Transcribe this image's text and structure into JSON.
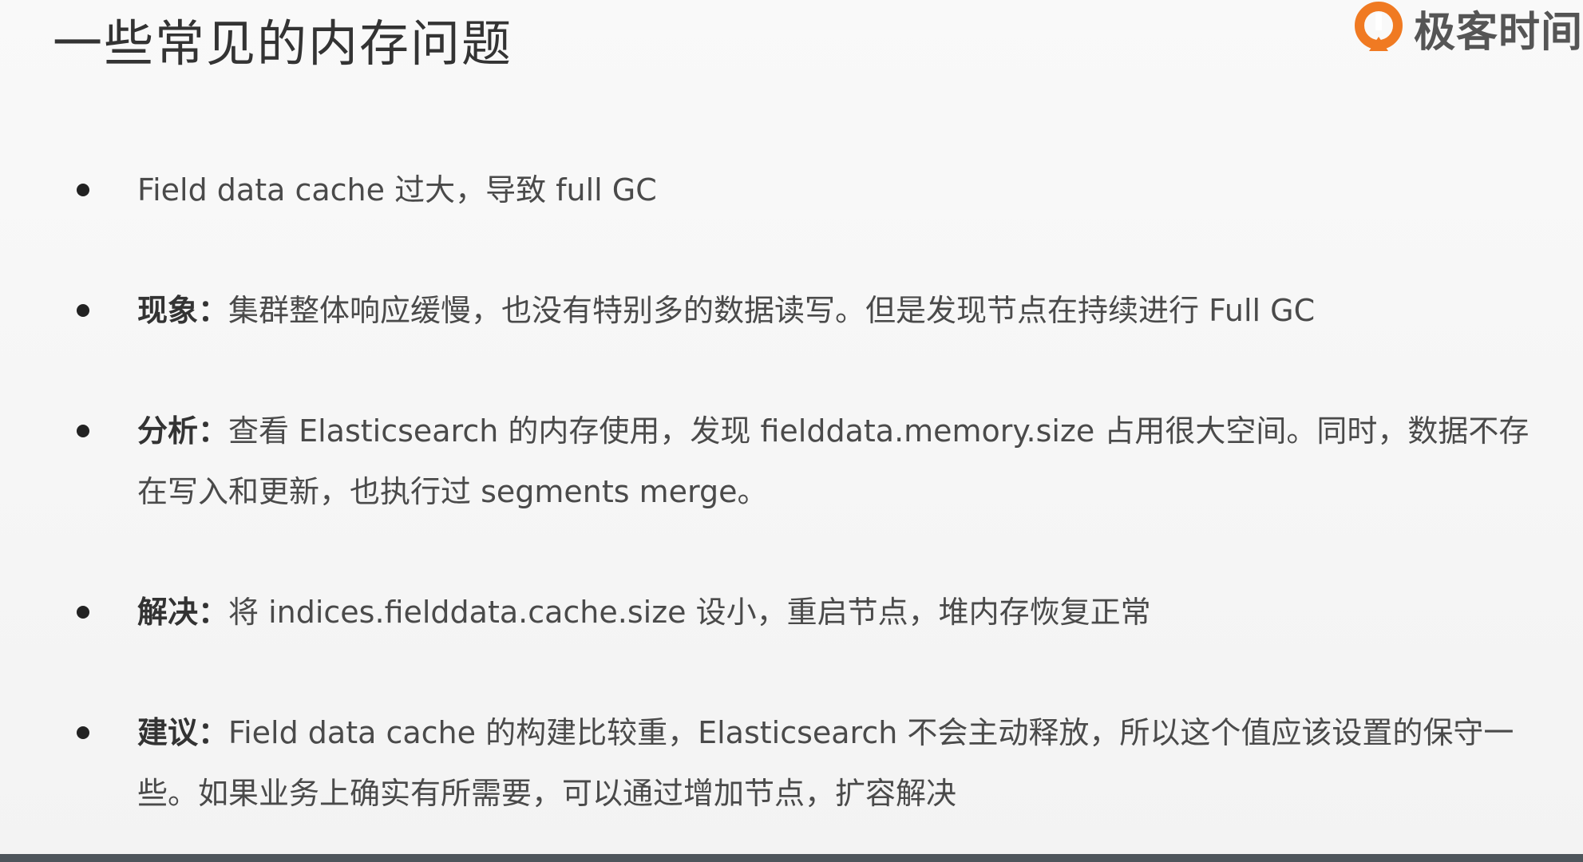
{
  "slide": {
    "title": "一些常见的内存问题",
    "logo_text": "极客时间",
    "bullets": [
      {
        "label": "",
        "text": "Field data cache 过大，导致 full GC"
      },
      {
        "label": "现象：",
        "text": "集群整体响应缓慢，也没有特别多的数据读写。但是发现节点在持续进行 Full GC"
      },
      {
        "label": "分析：",
        "text": "查看 Elasticsearch 的内存使用，发现 fielddata.memory.size 占用很大空间。同时，数据不存在写入和更新，也执行过 segments merge。"
      },
      {
        "label": "解决：",
        "text": "将 indices.fielddata.cache.size 设小，重启节点，堆内存恢复正常"
      },
      {
        "label": "建议：",
        "text": "Field data cache 的构建比较重，Elasticsearch 不会主动释放，所以这个值应该设置的保守一些。如果业务上确实有所需要，可以通过增加节点，扩容解决"
      }
    ]
  },
  "colors": {
    "logo_orange": "#f07a22",
    "text": "#4a4a4a",
    "bottom_bar": "#4e555b"
  },
  "icons": {
    "logo": "geektime-logo-icon",
    "bullet": "bullet-dot-icon"
  }
}
